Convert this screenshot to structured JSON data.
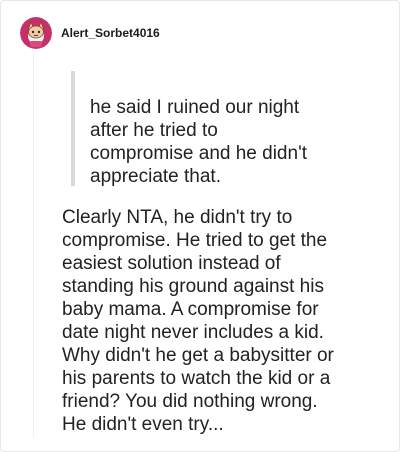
{
  "comment": {
    "username": "Alert_Sorbet4016",
    "avatar_icon": "snoo-avatar-icon",
    "quote_text": "he said I ruined our night\nafter he tried to\ncompromise and he didn't\nappreciate that.",
    "body_text": "Clearly NTA, he didn't try to\ncompromise. He tried to get the\neasiest solution instead of\nstanding his ground against his\nbaby mama. A compromise for\ndate night never includes a kid.\nWhy didn't he get a babysitter or\nhis parents to watch the kid or a\nfriend? You did nothing wrong.\nHe didn't even try..."
  },
  "colors": {
    "text": "#222222",
    "quote_bar": "#d9d9d9",
    "avatar_bg": "#c5306b",
    "border": "#e8e8e8"
  }
}
